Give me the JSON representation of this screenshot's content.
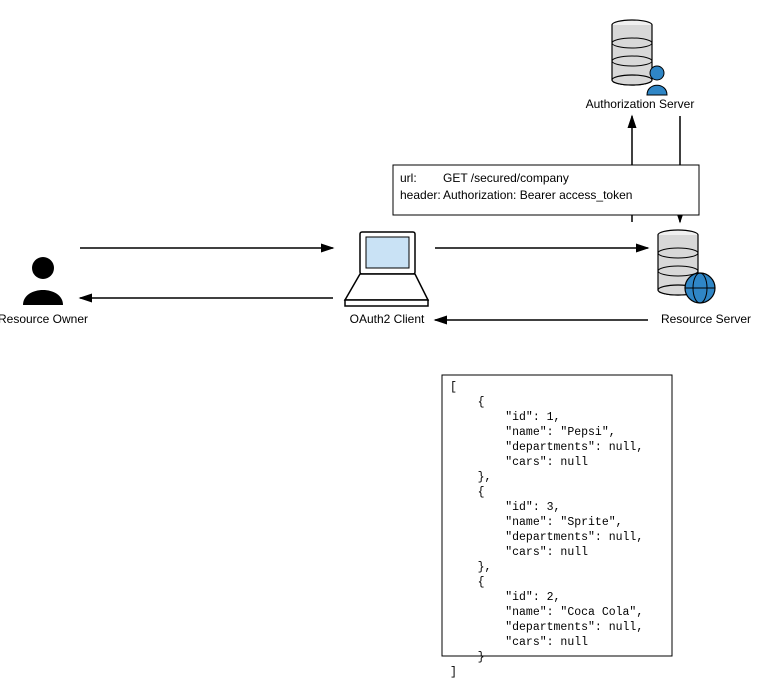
{
  "actors": {
    "resource_owner": "Resource Owner",
    "oauth2_client": "OAuth2 Client",
    "resource_server": "Resource Server",
    "authorization_server": "Authorization Server"
  },
  "request": {
    "url_label": "url:",
    "url_value": "GET /secured/company",
    "header_label": "header:",
    "header_value": "Authorization: Bearer access_token"
  },
  "response_json": "[\n    {\n        \"id\": 1,\n        \"name\": \"Pepsi\",\n        \"departments\": null,\n        \"cars\": null\n    },\n    {\n        \"id\": 3,\n        \"name\": \"Sprite\",\n        \"departments\": null,\n        \"cars\": null\n    },\n    {\n        \"id\": 2,\n        \"name\": \"Coca Cola\",\n        \"departments\": null,\n        \"cars\": null\n    }\n]"
}
